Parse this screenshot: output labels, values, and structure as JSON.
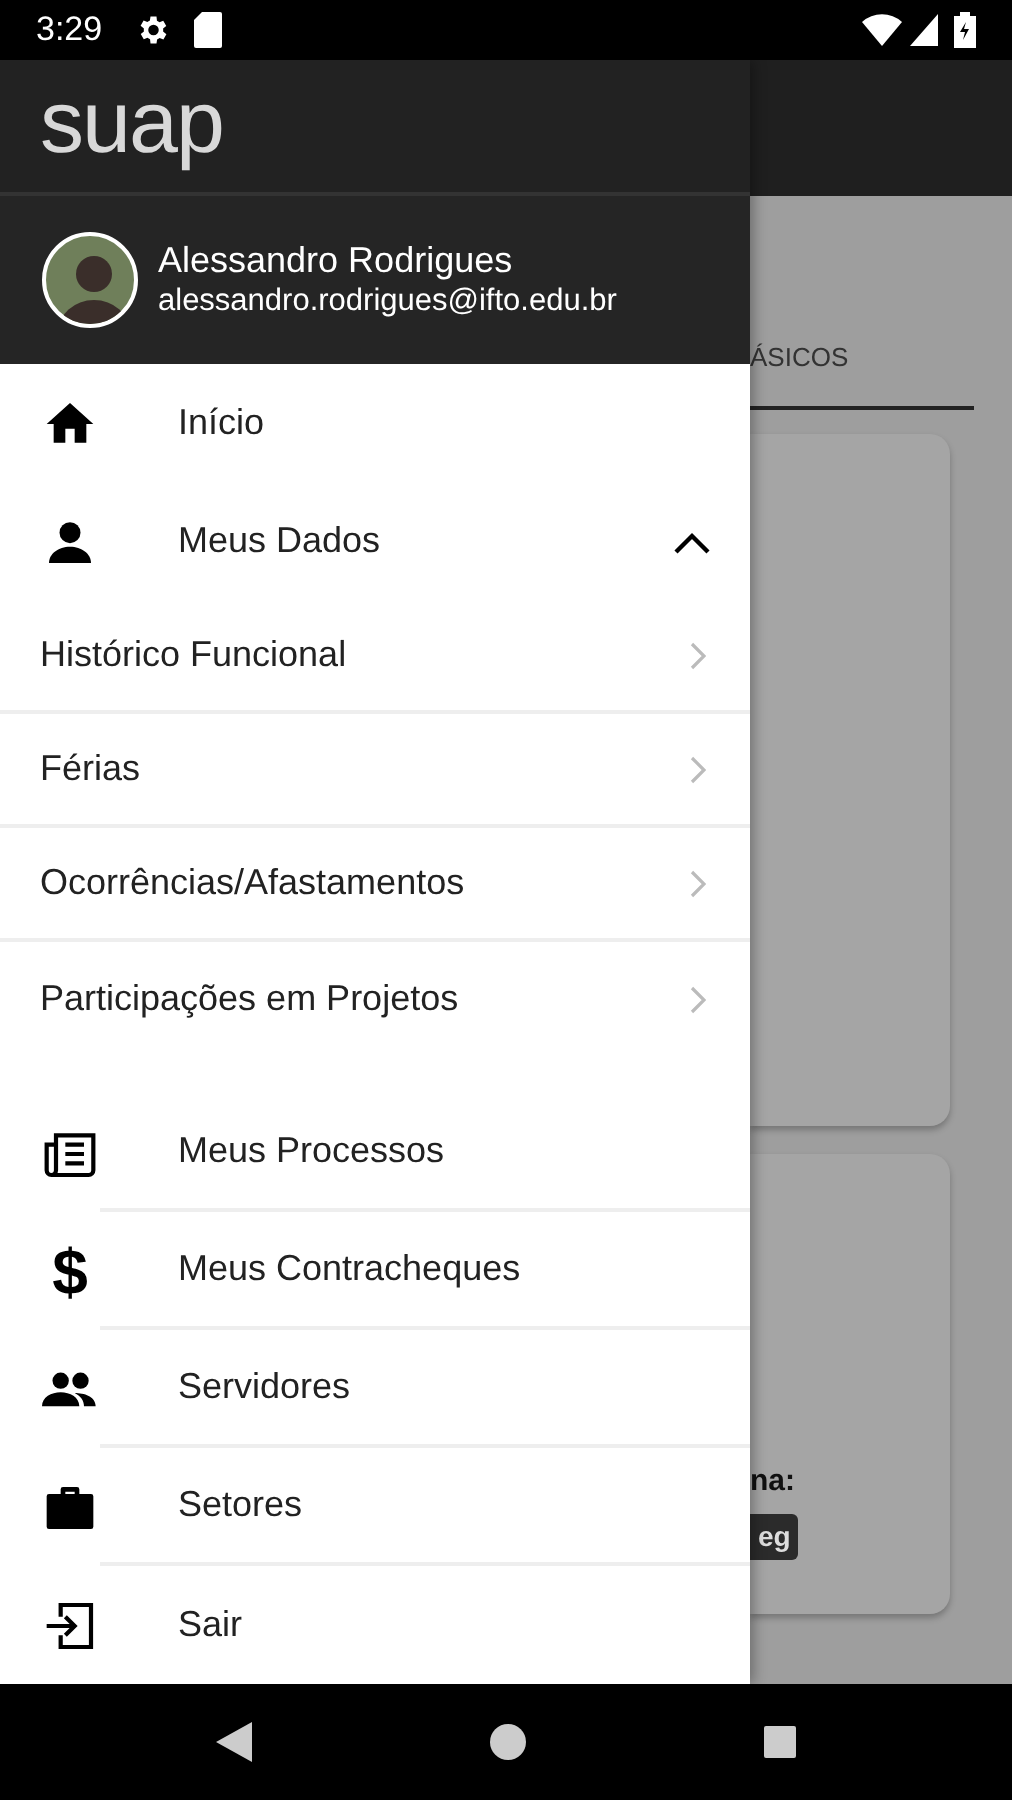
{
  "status_bar": {
    "time": "3:29"
  },
  "background": {
    "tab_label": "ÁSICOS",
    "field_label": "na:",
    "badge": "eg"
  },
  "drawer": {
    "logo": "suap",
    "user": {
      "name": "Alessandro Rodrigues",
      "email": "alessandro.rodrigues@ifto.edu.br"
    },
    "menu": [
      {
        "label": "Início"
      },
      {
        "label": "Meus Dados",
        "expanded": true,
        "children": [
          {
            "label": "Histórico Funcional"
          },
          {
            "label": "Férias"
          },
          {
            "label": "Ocorrências/Afastamentos"
          },
          {
            "label": "Participações em Projetos"
          }
        ]
      },
      {
        "label": "Meus Processos"
      },
      {
        "label": "Meus Contracheques",
        "icon_char": "$"
      },
      {
        "label": "Servidores"
      },
      {
        "label": "Setores"
      },
      {
        "label": "Sair"
      }
    ]
  }
}
